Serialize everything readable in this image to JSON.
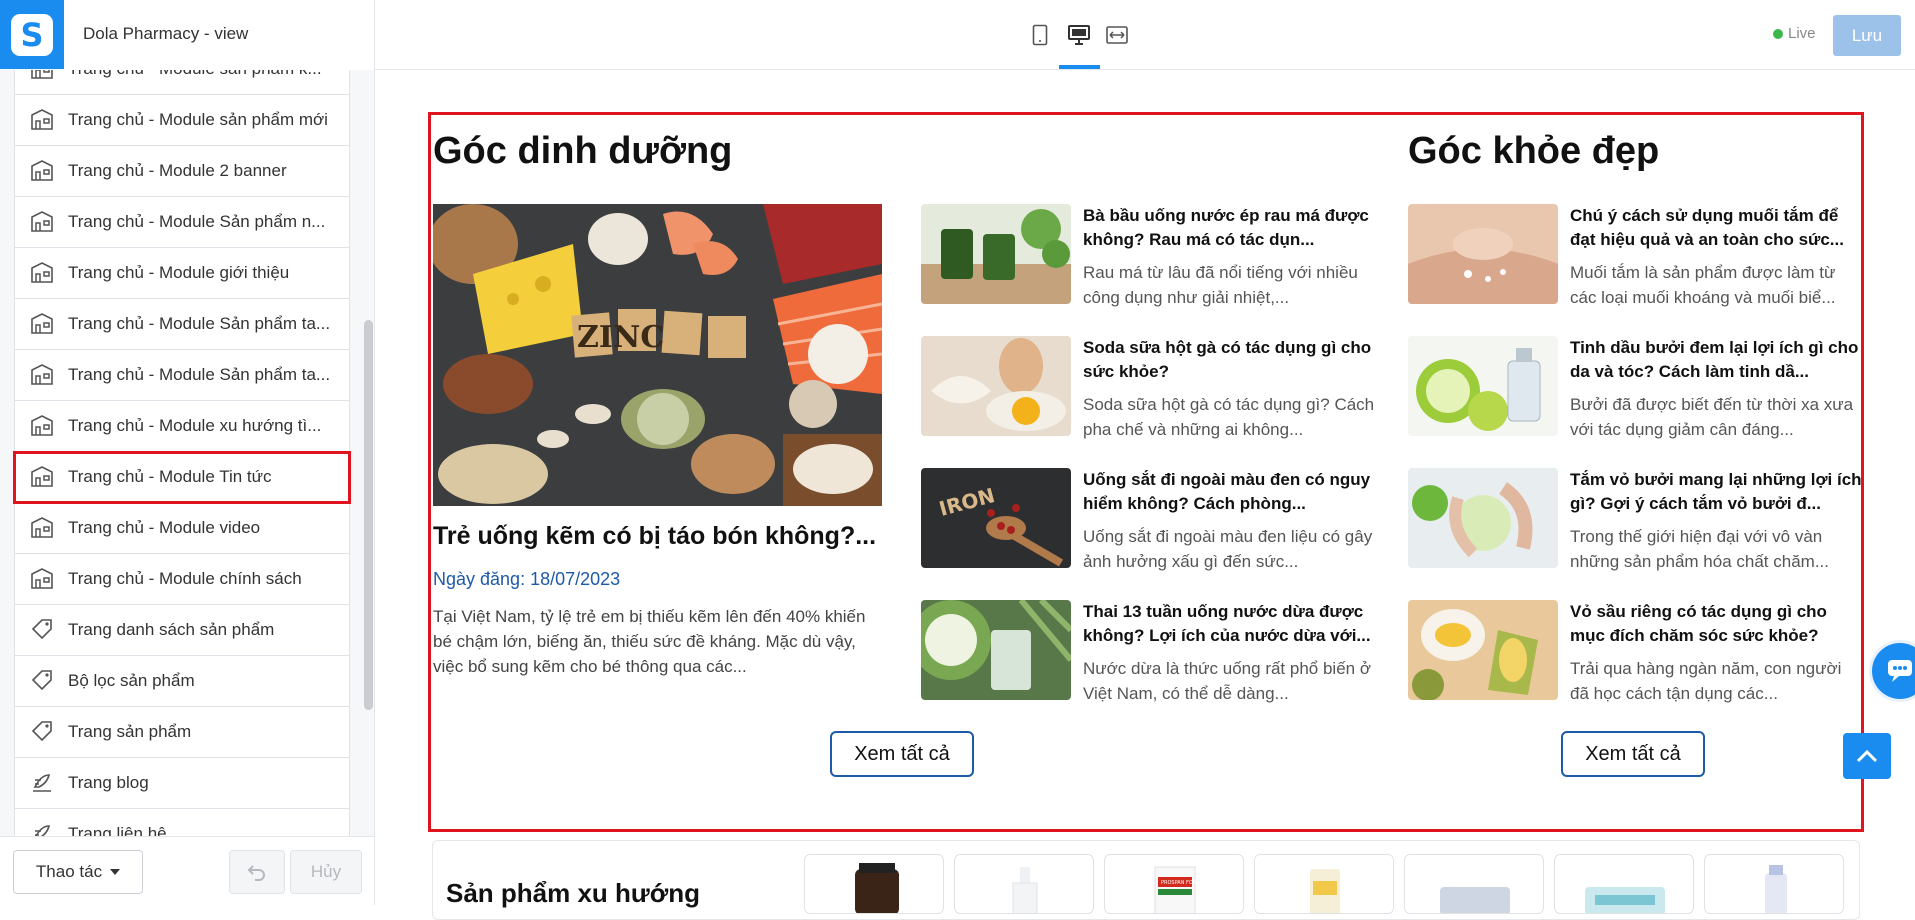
{
  "app": {
    "title": "Dola Pharmacy - view",
    "live_label": "Live",
    "save_label": "Lưu"
  },
  "sidebar": {
    "items": [
      {
        "label": "Trang chủ - Module sản phẩm k...",
        "icon": "layout-icon"
      },
      {
        "label": "Trang chủ - Module sản phẩm mới",
        "icon": "layout-icon"
      },
      {
        "label": "Trang chủ - Module 2 banner",
        "icon": "layout-icon"
      },
      {
        "label": "Trang chủ - Module Sản phẩm n...",
        "icon": "layout-icon"
      },
      {
        "label": "Trang chủ - Module giới thiệu",
        "icon": "layout-icon"
      },
      {
        "label": "Trang chủ - Module Sản phẩm ta...",
        "icon": "layout-icon"
      },
      {
        "label": "Trang chủ - Module Sản phẩm ta...",
        "icon": "layout-icon"
      },
      {
        "label": "Trang chủ - Module xu hướng tì...",
        "icon": "layout-icon"
      },
      {
        "label": "Trang chủ - Module Tin tức",
        "icon": "layout-icon",
        "active": true
      },
      {
        "label": "Trang chủ - Module video",
        "icon": "layout-icon"
      },
      {
        "label": "Trang chủ - Module chính sách",
        "icon": "layout-icon"
      },
      {
        "label": "Trang danh sách sản phẩm",
        "icon": "tag-icon"
      },
      {
        "label": "Bộ lọc sản phẩm",
        "icon": "tag-icon"
      },
      {
        "label": "Trang sản phẩm",
        "icon": "tag-icon"
      },
      {
        "label": "Trang blog",
        "icon": "blog-icon"
      },
      {
        "label": "Trang liên hệ",
        "icon": "blog-icon"
      }
    ],
    "actions_label": "Thao tác",
    "cancel_label": "Hủy"
  },
  "nutrition": {
    "title": "Góc dinh dưỡng",
    "featured": {
      "image_text": "ZINC",
      "title": "Trẻ uống kẽm có bị táo bón không?...",
      "date": "Ngày đăng: 18/07/2023",
      "desc": "Tại Việt Nam, tỷ lệ trẻ em bị thiếu kẽm lên đến 40% khiến bé chậm lớn, biếng ăn, thiếu sức đề kháng. Mặc dù vậy, việc bổ sung kẽm cho bé thông qua các..."
    },
    "articles": [
      {
        "title": "Bà bầu uống nước ép rau má được không? Rau má có tác dụn...",
        "desc": "Rau má từ lâu đã nổi tiếng với nhiều công dụng như giải nhiệt,..."
      },
      {
        "title": "Soda sữa hột gà có tác dụng gì cho sức khỏe?",
        "desc": "Soda sữa hột gà có tác dụng gì? Cách pha chế và những ai không..."
      },
      {
        "title": "Uống sắt đi ngoài màu đen có nguy hiểm không? Cách phòng...",
        "desc": "Uống sắt đi ngoài màu đen liệu có gây ảnh hưởng xấu gì đến sức...",
        "image_text": "IRON"
      },
      {
        "title": "Thai 13 tuần uống nước dừa được không? Lợi ích của nước dừa với...",
        "desc": "Nước dừa là thức uống rất phổ biến ở Việt Nam, có thể dễ dàng..."
      }
    ],
    "see_all": "Xem tất cả"
  },
  "beauty": {
    "title": "Góc khỏe đẹp",
    "articles": [
      {
        "title": "Chú ý cách sử dụng muối tắm để đạt hiệu quả và an toàn cho sức...",
        "desc": "Muối tắm là sản phẩm được làm từ các loại muối khoáng và muối biể..."
      },
      {
        "title": "Tinh dầu bưởi đem lại lợi ích gì cho da và tóc? Cách làm tinh dầ...",
        "desc": "Bưởi đã được biết đến từ thời xa xưa với tác dụng giảm cân đáng..."
      },
      {
        "title": "Tắm vỏ bưởi mang lại những lợi ích gì? Gợi ý cách tắm vỏ bưởi đ...",
        "desc": "Trong thế giới hiện đại với vô vàn những sản phẩm hóa chất chăm..."
      },
      {
        "title": "Vỏ sầu riêng có tác dụng gì cho mục đích chăm sóc sức khỏe?",
        "desc": "Trải qua hàng ngàn năm, con người đã học cách tận dụng các..."
      }
    ],
    "see_all": "Xem tất cả"
  },
  "trending": {
    "title": "Sản phẩm xu hướng",
    "product_label": "PROSPAN FORTE"
  },
  "chat": {
    "label": "Liên hệ"
  },
  "colors": {
    "accent": "#1a8cf0",
    "highlight": "#e0141e",
    "date": "#1e5aa8"
  }
}
